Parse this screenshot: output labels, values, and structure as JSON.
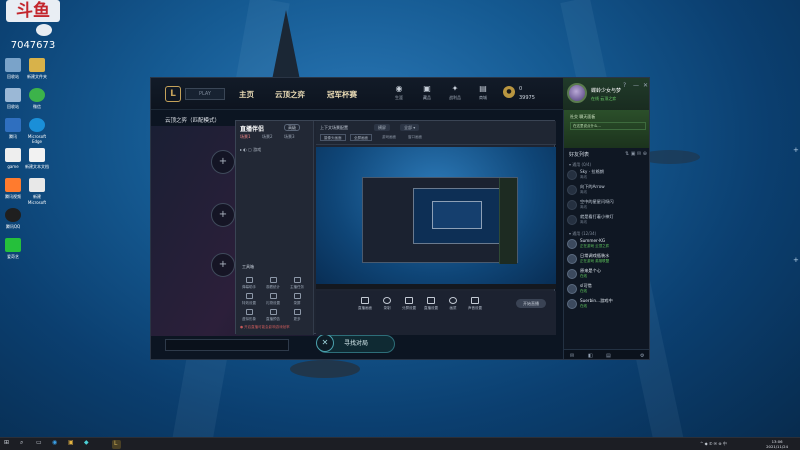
{
  "watermark": {
    "brand": "斗鱼",
    "room_number": "7047673"
  },
  "desktop_icons": [
    {
      "label": "回收站",
      "color": "#7aa3c9"
    },
    {
      "label": "新建文件夹",
      "color": "#d8b24a"
    },
    {
      "label": "回收站",
      "color": "#9bb8d6"
    },
    {
      "label": "微信",
      "color": "#3cb34a"
    },
    {
      "label": "腾讯",
      "color": "#2f6fbf"
    },
    {
      "label": "Microsoft Edge",
      "color": "#1a8fd8"
    },
    {
      "label": "game",
      "color": "#eeeeee"
    },
    {
      "label": "新建文本文档",
      "color": "#f2f2f2"
    },
    {
      "label": "腾讯视频",
      "color": "#ff7b2e"
    },
    {
      "label": "新建 Microsoft",
      "color": "#e8e8e8"
    },
    {
      "label": "腾讯QQ",
      "color": "#1f1f1f"
    },
    {
      "label": "爱奇艺",
      "color": "#25c03b"
    }
  ],
  "client": {
    "play_label": "PLAY",
    "nav": [
      "主页",
      "云顶之弈",
      "冠军杯赛"
    ],
    "top_icons": [
      {
        "label": "生涯",
        "glyph": "◉"
      },
      {
        "label": "藏品",
        "glyph": "▣"
      },
      {
        "label": "战利品",
        "glyph": "✦"
      },
      {
        "label": "商城",
        "glyph": "▤"
      }
    ],
    "currency": {
      "rp": "0",
      "be": "39975"
    },
    "window_controls": [
      "?",
      "—",
      "✕"
    ],
    "profile": {
      "name": "蝶蛉少女与梦",
      "status": "在线 云顶之弈"
    },
    "tft_title": "云顶之弈（匹配模式）",
    "slots": [
      "+",
      "+",
      "+",
      "+"
    ],
    "find_match": "寻找对局",
    "find_match_close": "✕"
  },
  "obs": {
    "app_name": "直播伴侣",
    "tag": "高级",
    "tabs": [
      "场景1",
      "场景2",
      "场景3"
    ],
    "scene_row": "▸ ◐ ▢ 游戏",
    "toolbox_label": "工具箱",
    "tools": [
      {
        "label": "弹幕助手"
      },
      {
        "label": "观看统计"
      },
      {
        "label": "主播任务"
      },
      {
        "label": "特效设置"
      },
      {
        "label": "礼物设置"
      },
      {
        "label": "录屏"
      },
      {
        "label": "虚拟形象"
      },
      {
        "label": "直播预告"
      },
      {
        "label": "更多"
      }
    ],
    "note": "● 开启直播可能会影响游戏帧率",
    "head_title": "上下文场景配置",
    "head_chips": [
      "横屏",
      "全部 ▾"
    ],
    "head_sub": [
      "摄像头画面",
      "全屏画面",
      "游戏画面",
      "窗口画面"
    ],
    "controls": [
      {
        "label": "直播画面"
      },
      {
        "label": "录制"
      },
      {
        "label": "分屏设置"
      },
      {
        "label": "直播设置"
      },
      {
        "label": "画质"
      },
      {
        "label": "声音设置"
      }
    ],
    "start_label": "开始直播"
  },
  "friends": {
    "banner_title": "社交 聊天面板",
    "banner_input": "在这里说点什么...",
    "title": "好友列表",
    "tools": "⇅ ▣ ✉ ⊕",
    "groups": [
      {
        "name": "▾ 通用 (0/4)"
      },
      {
        "name": "▾ 通用 (12/34)"
      }
    ],
    "list": [
      {
        "name": "Sky · 拉格朗",
        "status": "离线",
        "online": false
      },
      {
        "name": "向下的Arrow",
        "status": "离线",
        "online": false
      },
      {
        "name": "空中的星星闪呀闪",
        "status": "离线",
        "online": false
      },
      {
        "name": "就是看打着小神灯",
        "status": "离线",
        "online": false
      },
      {
        "name": "Summer·KG",
        "status": "正在游戏 云顶之弈",
        "online": true
      },
      {
        "name": "日常调戏瓶装水",
        "status": "正在游戏 英雄联盟",
        "online": true
      },
      {
        "name": "原来是个心",
        "status": "在线",
        "online": true
      },
      {
        "name": "sl可惜",
        "status": "在线",
        "online": true
      },
      {
        "name": "Suerbin...游戏中",
        "status": "在线",
        "online": true
      }
    ],
    "bottom": [
      "✉",
      "◧",
      "▤",
      "⚙"
    ]
  },
  "taskbar": {
    "icons": [
      "⊞",
      "⌕",
      "▭",
      "◉",
      "▣",
      "◆",
      "L"
    ],
    "tray": "^ ◆ ✆ ✉ ⊕ 中",
    "time": "13:06",
    "date": "2021/11/24"
  }
}
